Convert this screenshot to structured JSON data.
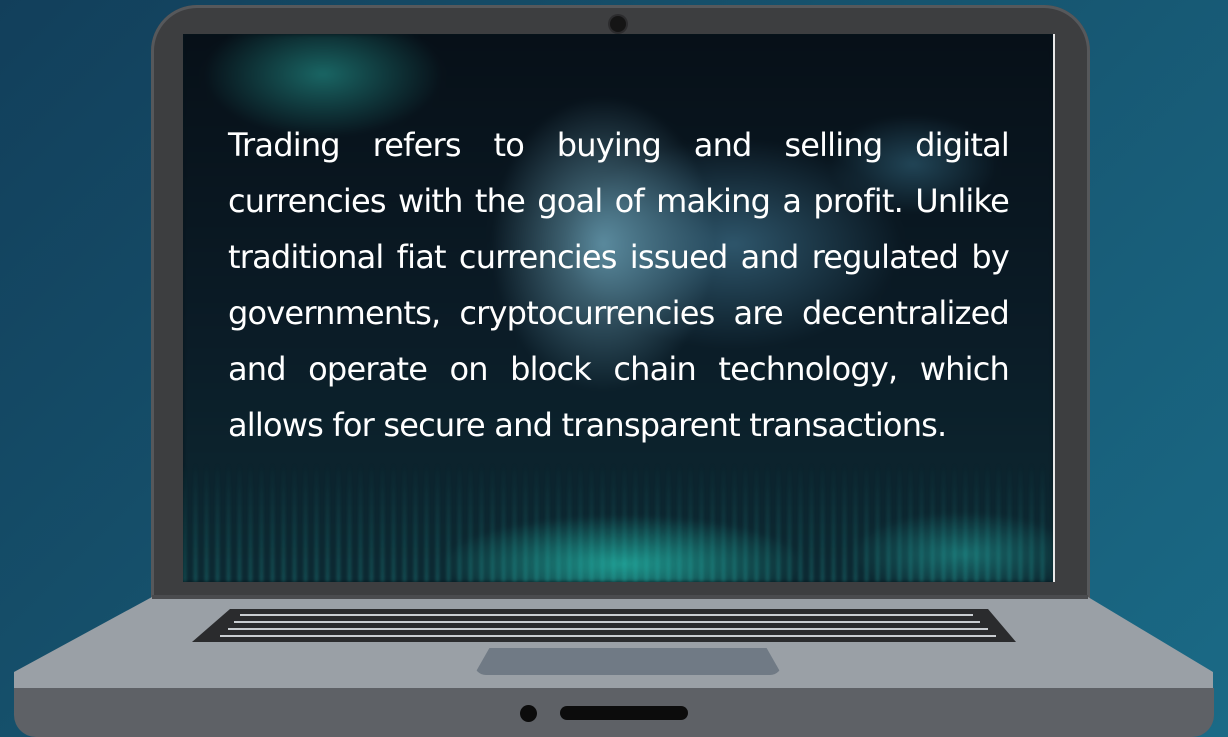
{
  "laptop": {
    "screen_text": "Trading refers to buying and selling digital currencies with the goal of making a profit. Unlike traditional fiat currencies issued and regulated by governments, cryptocurrencies are decentralized and operate on block chain technology, which allows for secure and transparent transactions."
  },
  "colors": {
    "background": "#16536e",
    "laptop_lid": "#3d3e40",
    "laptop_base": "#9aa0a6",
    "laptop_front": "#5e6166",
    "screen_text": "#ffffff"
  }
}
